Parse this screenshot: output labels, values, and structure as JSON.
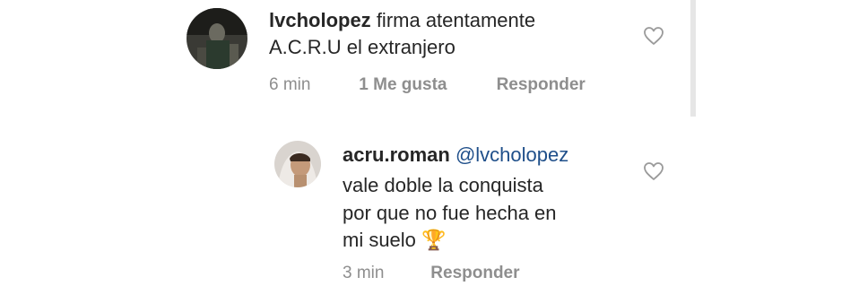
{
  "comments": [
    {
      "username": "lvcholopez",
      "text_line1": "firma atentamente",
      "text_line2": "A.C.R.U el extranjero",
      "time": "6 min",
      "likes": "1 Me gusta",
      "reply": "Responder"
    },
    {
      "username": "acru.roman",
      "mention": "@lvcholopez",
      "text_line1": "vale doble la conquista",
      "text_line2": "por que no fue hecha en",
      "text_line3": "mi suelo",
      "emoji": "🏆",
      "time": "3 min",
      "reply": "Responder"
    }
  ],
  "colors": {
    "mention": "#1f4f8a",
    "meta": "#8e8e8e",
    "text": "#262626"
  },
  "icons": {
    "like": "heart-outline-icon"
  }
}
